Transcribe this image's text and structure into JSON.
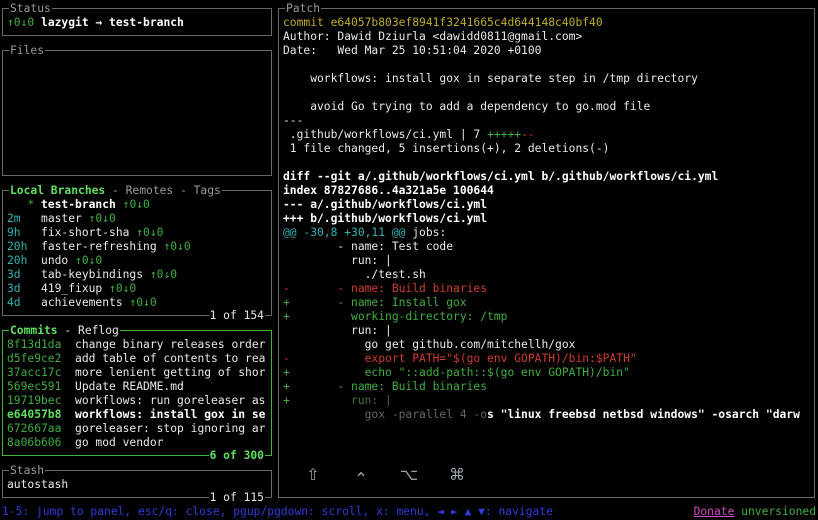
{
  "panels": {
    "status": {
      "title": [
        [
          "gray",
          "Status"
        ]
      ],
      "lines": [
        [
          [
            "g",
            "↑0↓0"
          ],
          [
            "wb",
            " lazygit → test-branch"
          ]
        ]
      ]
    },
    "files": {
      "title": [
        [
          "gray",
          "Files"
        ]
      ],
      "lines": []
    },
    "branches": {
      "title": [
        [
          "gb",
          "Local Branches"
        ],
        [
          "gray",
          " - Remotes - Tags"
        ]
      ],
      "count": [
        [
          "w",
          "1 of 154"
        ]
      ],
      "lines": [
        [
          [
            "g",
            "   * "
          ],
          [
            "wb",
            "test-branch"
          ],
          [
            "g",
            " ↑0↓0"
          ]
        ],
        [
          [
            "c",
            "2m   "
          ],
          [
            "w",
            "master "
          ],
          [
            "g",
            "↑0↓0"
          ]
        ],
        [
          [
            "c",
            "9h   "
          ],
          [
            "w",
            "fix-short-sha "
          ],
          [
            "g",
            "↑0↓0"
          ]
        ],
        [
          [
            "c",
            "20h  "
          ],
          [
            "w",
            "faster-refreshing "
          ],
          [
            "g",
            "↑0↓0"
          ]
        ],
        [
          [
            "c",
            "20h  "
          ],
          [
            "w",
            "undo "
          ],
          [
            "g",
            "↑0↓0"
          ]
        ],
        [
          [
            "c",
            "3d   "
          ],
          [
            "w",
            "tab-keybindings "
          ],
          [
            "g",
            "↑0↓0"
          ]
        ],
        [
          [
            "c",
            "3d   "
          ],
          [
            "w",
            "419_fixup "
          ],
          [
            "g",
            "↑0↓0"
          ]
        ],
        [
          [
            "c",
            "4d   "
          ],
          [
            "w",
            "achievements "
          ],
          [
            "g",
            "↑0↓0"
          ]
        ]
      ]
    },
    "commits": {
      "title": [
        [
          "gb",
          "Commits"
        ],
        [
          "w",
          " - Reflog"
        ]
      ],
      "count": [
        [
          "gb",
          "6 of 300"
        ]
      ],
      "lines": [
        [
          [
            "g",
            "8f13d1da  "
          ],
          [
            "w",
            "change binary releases order"
          ]
        ],
        [
          [
            "g",
            "d5fe9ce2  "
          ],
          [
            "w",
            "add table of contents to rea"
          ]
        ],
        [
          [
            "g",
            "37acc17c  "
          ],
          [
            "w",
            "more lenient getting of shor"
          ]
        ],
        [
          [
            "g",
            "569ec591  "
          ],
          [
            "w",
            "Update README.md"
          ]
        ],
        [
          [
            "g",
            "19719bec  "
          ],
          [
            "w",
            "workflows: run goreleaser as"
          ]
        ],
        [
          [
            "gb",
            "e64057b8  "
          ],
          [
            "wb",
            "workflows: install gox in se"
          ]
        ],
        [
          [
            "g",
            "672667aa  "
          ],
          [
            "w",
            "goreleaser: stop ignoring ar"
          ]
        ],
        [
          [
            "g",
            "8a06b606  "
          ],
          [
            "w",
            "go mod vendor"
          ]
        ]
      ]
    },
    "stash": {
      "title": [
        [
          "gray",
          "Stash"
        ]
      ],
      "count": [
        [
          "w",
          "1 of 115"
        ]
      ],
      "lines": [
        [
          [
            "w",
            "autostash"
          ]
        ]
      ]
    },
    "patch": {
      "title": [
        [
          "gray",
          "Patch"
        ]
      ],
      "lines": [
        [
          [
            "y",
            "commit e64057b803ef8941f3241665c4d644148c40bf40"
          ]
        ],
        [
          [
            "w",
            "Author: Dawid Dziurla <dawidd0811@gmail.com>"
          ]
        ],
        [
          [
            "w",
            "Date:   Wed Mar 25 10:51:04 2020 +0100"
          ]
        ],
        [],
        [
          [
            "w",
            "    workflows: install gox in separate step in /tmp directory"
          ]
        ],
        [],
        [
          [
            "w",
            "    avoid Go trying to add a dependency to go.mod file"
          ]
        ],
        [
          [
            "w",
            "---"
          ]
        ],
        [
          [
            "w",
            " .github/workflows/ci.yml | 7 "
          ],
          [
            "g",
            "+++++"
          ],
          [
            "r",
            "--"
          ]
        ],
        [
          [
            "w",
            " 1 file changed, 5 insertions(+), 2 deletions(-)"
          ]
        ],
        [],
        [
          [
            "wb",
            "diff --git a/.github/workflows/ci.yml b/.github/workflows/ci.yml"
          ]
        ],
        [
          [
            "wb",
            "index 87827686..4a321a5e 100644"
          ]
        ],
        [
          [
            "wb",
            "--- a/.github/workflows/ci.yml"
          ]
        ],
        [
          [
            "wb",
            "+++ b/.github/workflows/ci.yml"
          ]
        ],
        [
          [
            "c",
            "@@ -30,8 +30,11 @@"
          ],
          [
            "w",
            " jobs:"
          ]
        ],
        [
          [
            "w",
            "        - name: Test code"
          ]
        ],
        [
          [
            "w",
            "          run: |"
          ]
        ],
        [
          [
            "w",
            "            ./test.sh"
          ]
        ],
        [
          [
            "r",
            "-       - name: Build binaries"
          ]
        ],
        [
          [
            "g",
            "+       - name: Install gox"
          ]
        ],
        [
          [
            "g",
            "+         working-directory: /tmp"
          ]
        ],
        [
          [
            "w",
            "          run: |"
          ]
        ],
        [
          [
            "w",
            "            go get github.com/mitchellh/gox"
          ]
        ],
        [
          [
            "r",
            "-           export PATH=\"$(go env GOPATH)/bin:$PATH\""
          ]
        ],
        [
          [
            "g",
            "+           echo \"::add-path::$(go env GOPATH)/bin\""
          ]
        ],
        [
          [
            "g",
            "+       - name: Build binaries"
          ]
        ],
        [
          [
            "g",
            "+"
          ],
          [
            "dimg",
            "         run: |"
          ]
        ],
        [
          [
            "dimw",
            "            gox -parallel 4 -o"
          ],
          [
            "wb",
            "s \"linux freebsd netbsd windows\" -osarch \"darw"
          ]
        ]
      ]
    }
  },
  "keycast": [
    [
      "key",
      "⇧"
    ],
    [
      "keyc",
      "⌃"
    ],
    [
      "key",
      "⌥"
    ],
    [
      "key",
      "⌘"
    ]
  ],
  "statusbar": {
    "hints": [
      [
        "blue",
        "1-5: jump to panel, esc/q: close, pgup/pgdown: scroll, x: menu, ◄ ► ▲ ▼: navigate"
      ]
    ],
    "donate": [
      [
        "mag",
        "Donate"
      ]
    ],
    "version": [
      [
        "g",
        " unversioned"
      ]
    ]
  }
}
